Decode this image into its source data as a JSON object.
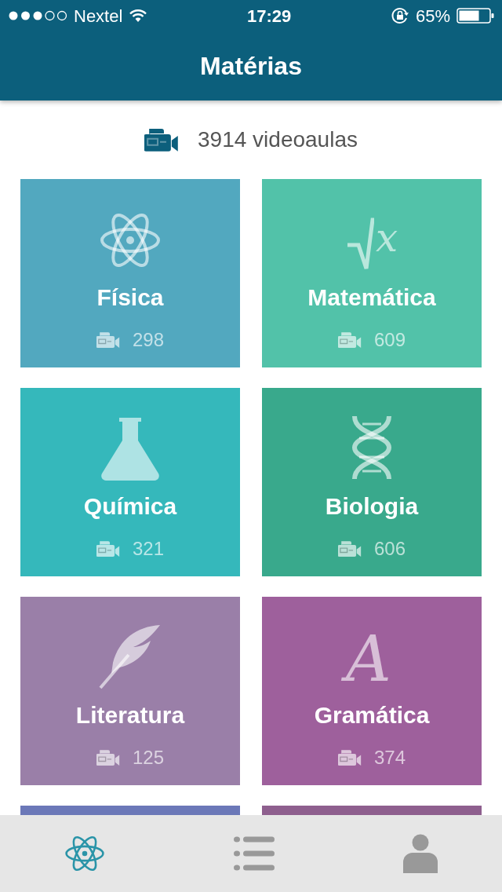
{
  "status_bar": {
    "carrier": "Nextel",
    "time": "17:29",
    "battery": "65%"
  },
  "header": {
    "title": "Matérias"
  },
  "summary": {
    "text": "3914 videoaulas"
  },
  "subjects": [
    {
      "name": "Física",
      "count": "298",
      "kind": "atom",
      "color": "#52a8bf"
    },
    {
      "name": "Matemática",
      "count": "609",
      "kind": "root",
      "color": "#52c2a9"
    },
    {
      "name": "Química",
      "count": "321",
      "kind": "flask",
      "color": "#35b8bb"
    },
    {
      "name": "Biologia",
      "count": "606",
      "kind": "dna",
      "color": "#39a98c"
    },
    {
      "name": "Literatura",
      "count": "125",
      "kind": "feather",
      "color": "#9a7fa8"
    },
    {
      "name": "Gramática",
      "count": "374",
      "kind": "letter",
      "color": "#9e609c"
    },
    {
      "color": "#6b78b8"
    },
    {
      "color": "#8e5f8e"
    }
  ],
  "icon_glyphs": [
    "x",
    "A"
  ],
  "tab_bar": [
    {
      "kind": "atom",
      "selected": true
    },
    {
      "kind": "list",
      "selected": false
    },
    {
      "kind": "person",
      "selected": false
    }
  ]
}
